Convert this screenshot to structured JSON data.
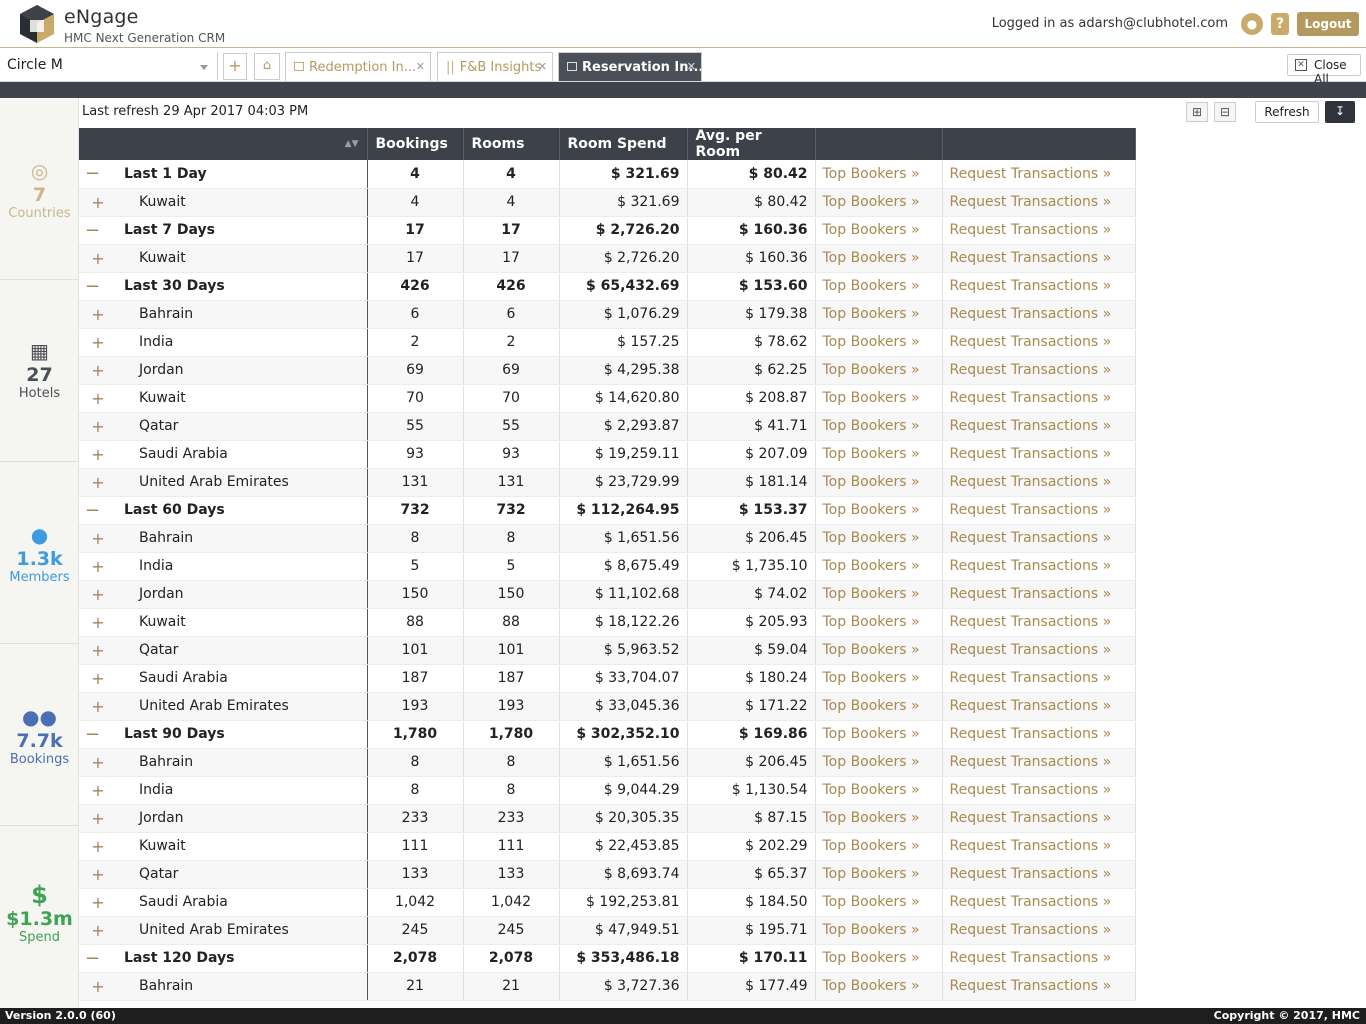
{
  "header": {
    "brand": "eNgage",
    "subtitle": "HMC Next Generation CRM",
    "logged_in": "Logged in as adarsh@clubhotel.com",
    "help": "?",
    "logout": "Logout",
    "accent_color": "#b59a5f"
  },
  "tabbar": {
    "selector_value": "Circle M",
    "add": "+",
    "tabs": [
      {
        "label": "Redemption In...",
        "icon": "table-icon",
        "active": false
      },
      {
        "label": "F&B Insights",
        "icon": "utensils-icon",
        "active": false
      },
      {
        "label": "Reservation In...",
        "icon": "hotel-icon",
        "active": true
      }
    ],
    "close_all": "Close All"
  },
  "sidebar": {
    "stats": [
      {
        "icon": "globe-icon",
        "value": "7",
        "label": "Countries",
        "color": "#c9b68c"
      },
      {
        "icon": "building-icon",
        "value": "27",
        "label": "Hotels",
        "color": "#4b4f58"
      },
      {
        "icon": "user-icon",
        "value": "1.3k",
        "label": "Members",
        "color": "#3d9be0"
      },
      {
        "icon": "users-icon",
        "value": "7.7k",
        "label": "Bookings",
        "color": "#4a6fb5"
      },
      {
        "icon": "dollar-icon",
        "value": "$1.3m",
        "label": "Spend",
        "color": "#3ea354"
      }
    ]
  },
  "toolbar": {
    "last_refresh": "Last refresh 29 Apr 2017 04:03 PM",
    "refresh": "Refresh"
  },
  "table": {
    "columns": [
      "Bookings",
      "Rooms",
      "Room Spend",
      "Avg. per Room"
    ],
    "link1": "Top Bookers »",
    "link2": "Request Transactions »",
    "rows": [
      {
        "type": "group",
        "name": "Last 1 Day",
        "bookings": "4",
        "rooms": "4",
        "spend": "$ 321.69",
        "avg": "$ 80.42"
      },
      {
        "type": "child",
        "name": "Kuwait",
        "bookings": "4",
        "rooms": "4",
        "spend": "$ 321.69",
        "avg": "$ 80.42"
      },
      {
        "type": "group",
        "name": "Last 7 Days",
        "bookings": "17",
        "rooms": "17",
        "spend": "$ 2,726.20",
        "avg": "$ 160.36"
      },
      {
        "type": "child",
        "name": "Kuwait",
        "bookings": "17",
        "rooms": "17",
        "spend": "$ 2,726.20",
        "avg": "$ 160.36"
      },
      {
        "type": "group",
        "name": "Last 30 Days",
        "bookings": "426",
        "rooms": "426",
        "spend": "$ 65,432.69",
        "avg": "$ 153.60"
      },
      {
        "type": "child",
        "name": "Bahrain",
        "bookings": "6",
        "rooms": "6",
        "spend": "$ 1,076.29",
        "avg": "$ 179.38"
      },
      {
        "type": "child",
        "name": "India",
        "bookings": "2",
        "rooms": "2",
        "spend": "$ 157.25",
        "avg": "$ 78.62"
      },
      {
        "type": "child",
        "name": "Jordan",
        "bookings": "69",
        "rooms": "69",
        "spend": "$ 4,295.38",
        "avg": "$ 62.25"
      },
      {
        "type": "child",
        "name": "Kuwait",
        "bookings": "70",
        "rooms": "70",
        "spend": "$ 14,620.80",
        "avg": "$ 208.87"
      },
      {
        "type": "child",
        "name": "Qatar",
        "bookings": "55",
        "rooms": "55",
        "spend": "$ 2,293.87",
        "avg": "$ 41.71"
      },
      {
        "type": "child",
        "name": "Saudi Arabia",
        "bookings": "93",
        "rooms": "93",
        "spend": "$ 19,259.11",
        "avg": "$ 207.09"
      },
      {
        "type": "child",
        "name": "United Arab Emirates",
        "bookings": "131",
        "rooms": "131",
        "spend": "$ 23,729.99",
        "avg": "$ 181.14"
      },
      {
        "type": "group",
        "name": "Last 60 Days",
        "bookings": "732",
        "rooms": "732",
        "spend": "$ 112,264.95",
        "avg": "$ 153.37"
      },
      {
        "type": "child",
        "name": "Bahrain",
        "bookings": "8",
        "rooms": "8",
        "spend": "$ 1,651.56",
        "avg": "$ 206.45"
      },
      {
        "type": "child",
        "name": "India",
        "bookings": "5",
        "rooms": "5",
        "spend": "$ 8,675.49",
        "avg": "$ 1,735.10"
      },
      {
        "type": "child",
        "name": "Jordan",
        "bookings": "150",
        "rooms": "150",
        "spend": "$ 11,102.68",
        "avg": "$ 74.02"
      },
      {
        "type": "child",
        "name": "Kuwait",
        "bookings": "88",
        "rooms": "88",
        "spend": "$ 18,122.26",
        "avg": "$ 205.93"
      },
      {
        "type": "child",
        "name": "Qatar",
        "bookings": "101",
        "rooms": "101",
        "spend": "$ 5,963.52",
        "avg": "$ 59.04"
      },
      {
        "type": "child",
        "name": "Saudi Arabia",
        "bookings": "187",
        "rooms": "187",
        "spend": "$ 33,704.07",
        "avg": "$ 180.24"
      },
      {
        "type": "child",
        "name": "United Arab Emirates",
        "bookings": "193",
        "rooms": "193",
        "spend": "$ 33,045.36",
        "avg": "$ 171.22"
      },
      {
        "type": "group",
        "name": "Last 90 Days",
        "bookings": "1,780",
        "rooms": "1,780",
        "spend": "$ 302,352.10",
        "avg": "$ 169.86"
      },
      {
        "type": "child",
        "name": "Bahrain",
        "bookings": "8",
        "rooms": "8",
        "spend": "$ 1,651.56",
        "avg": "$ 206.45"
      },
      {
        "type": "child",
        "name": "India",
        "bookings": "8",
        "rooms": "8",
        "spend": "$ 9,044.29",
        "avg": "$ 1,130.54"
      },
      {
        "type": "child",
        "name": "Jordan",
        "bookings": "233",
        "rooms": "233",
        "spend": "$ 20,305.35",
        "avg": "$ 87.15"
      },
      {
        "type": "child",
        "name": "Kuwait",
        "bookings": "111",
        "rooms": "111",
        "spend": "$ 22,453.85",
        "avg": "$ 202.29"
      },
      {
        "type": "child",
        "name": "Qatar",
        "bookings": "133",
        "rooms": "133",
        "spend": "$ 8,693.74",
        "avg": "$ 65.37"
      },
      {
        "type": "child",
        "name": "Saudi Arabia",
        "bookings": "1,042",
        "rooms": "1,042",
        "spend": "$ 192,253.81",
        "avg": "$ 184.50"
      },
      {
        "type": "child",
        "name": "United Arab Emirates",
        "bookings": "245",
        "rooms": "245",
        "spend": "$ 47,949.51",
        "avg": "$ 195.71"
      },
      {
        "type": "group",
        "name": "Last 120 Days",
        "bookings": "2,078",
        "rooms": "2,078",
        "spend": "$ 353,486.18",
        "avg": "$ 170.11"
      },
      {
        "type": "child",
        "name": "Bahrain",
        "bookings": "21",
        "rooms": "21",
        "spend": "$ 3,727.36",
        "avg": "$ 177.49"
      }
    ]
  },
  "footer": {
    "version": "Version 2.0.0 (60)",
    "copyright": "Copyright © 2017, HMC"
  }
}
